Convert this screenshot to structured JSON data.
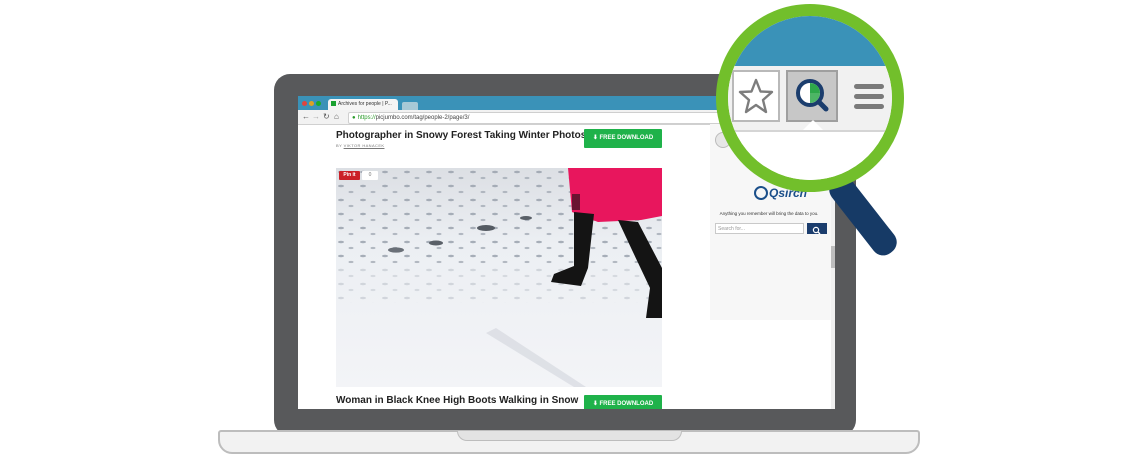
{
  "browser": {
    "tab_title": "Archives for people | P...",
    "url_https": "https://",
    "url_rest": "picjumbo.com/tag/people-2/page/3/"
  },
  "posts": [
    {
      "title": "Photographer in Snowy Forest Taking Winter Photos",
      "byline_prefix": "BY",
      "author": "VIKTOR HANACEK",
      "download_label": "FREE DOWNLOAD"
    },
    {
      "title": "Woman in Black Knee High Boots Walking in Snow",
      "download_label": "FREE DOWNLOAD"
    }
  ],
  "pinit": {
    "label": "Pin it",
    "count": "0"
  },
  "qsirch": {
    "logo_text": "Qsirch",
    "tagline": "Anything you remember will bring the data to you.",
    "search_placeholder": "Search for..."
  },
  "icons": {
    "star": "star-icon",
    "qsirch": "qsirch-icon",
    "menu": "hamburger-menu-icon",
    "download": "download-icon",
    "search": "search-icon"
  },
  "colors": {
    "download_green": "#1fb24a",
    "tab_bar_blue": "#3a92b8",
    "lens_ring_green": "#72bf2b",
    "handle_navy": "#163a66",
    "coat_pink": "#e8165d",
    "pin_red": "#cb2027"
  }
}
